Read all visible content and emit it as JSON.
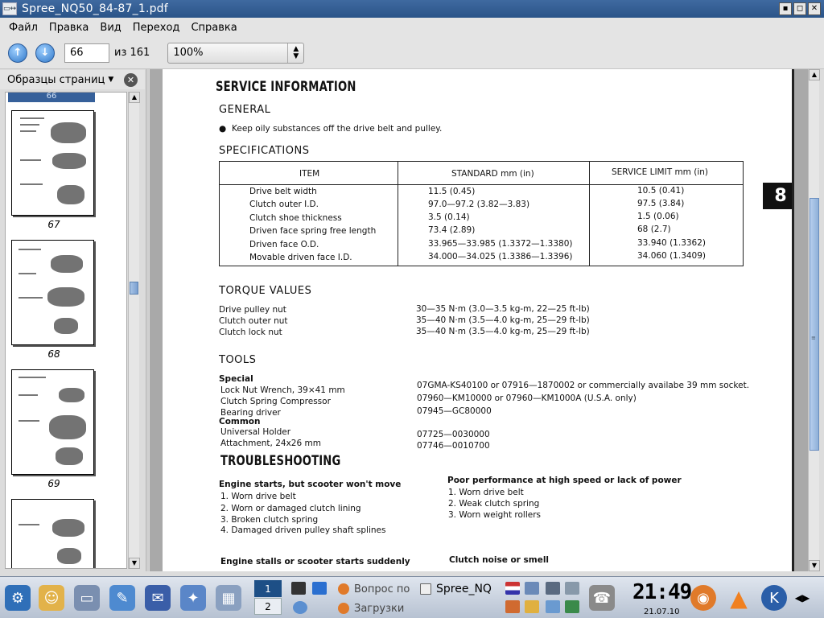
{
  "window": {
    "title": "Spree_NQ50_84-87_1.pdf"
  },
  "menu": [
    "Файл",
    "Правка",
    "Вид",
    "Переход",
    "Справка"
  ],
  "toolbar": {
    "page_value": "66",
    "of_label": "из 161",
    "zoom_value": "100%"
  },
  "sidebar": {
    "title": "Образцы страниц",
    "thumbs": [
      {
        "label": "66"
      },
      {
        "label": "67"
      },
      {
        "label": "68"
      },
      {
        "label": "69"
      }
    ]
  },
  "doc": {
    "service_title": "SERVICE INFORMATION",
    "general_title": "GENERAL",
    "general_bullet": "Keep oily substances off the drive belt and pulley.",
    "spec_title": "SPECIFICATIONS",
    "spec_headers": {
      "item": "ITEM",
      "standard": "STANDARD mm (in)",
      "limit": "SERVICE LIMIT mm (in)"
    },
    "spec_rows": [
      {
        "item": "Drive belt width",
        "std": "11.5 (0.45)",
        "lim": "10.5 (0.41)"
      },
      {
        "item": "Clutch outer I.D.",
        "std": "97.0—97.2 (3.82—3.83)",
        "lim": "97.5 (3.84)"
      },
      {
        "item": "Clutch shoe thickness",
        "std": "3.5 (0.14)",
        "lim": "1.5 (0.06)"
      },
      {
        "item": "Driven face spring free length",
        "std": "73.4 (2.89)",
        "lim": "68 (2.7)"
      },
      {
        "item": "Driven face O.D.",
        "std": "33.965—33.985 (1.3372—1.3380)",
        "lim": "33.940 (1.3362)"
      },
      {
        "item": "Movable driven face I.D.",
        "std": "34.000—34.025 (1.3386—1.3396)",
        "lim": "34.060 (1.3409)"
      }
    ],
    "chapter_badge": "8",
    "torque_title": "TORQUE VALUES",
    "torque_rows": [
      {
        "name": "Drive pulley nut",
        "val": "30—35 N·m (3.0—3.5 kg-m, 22—25 ft-lb)"
      },
      {
        "name": "Clutch outer nut",
        "val": "35—40 N·m (3.5—4.0 kg-m, 25—29 ft-lb)"
      },
      {
        "name": "Clutch lock nut",
        "val": "35—40 N·m (3.5—4.0 kg-m, 25—29 ft-lb)"
      }
    ],
    "tools_title": "TOOLS",
    "tools_special": "Special",
    "tools_common": "Common",
    "tools_rows": [
      {
        "name": "Lock Nut Wrench, 39×41 mm",
        "val": "07GMA-KS40100 or 07916—1870002 or commercially availabe 39 mm socket."
      },
      {
        "name": "Clutch Spring Compressor",
        "val": "07960—KM10000 or 07960—KM1000A (U.S.A. only)"
      },
      {
        "name": "Bearing driver",
        "val": "07945—GC80000"
      },
      {
        "name": "Universal Holder",
        "val": "07725—0030000"
      },
      {
        "name": "Attachment, 24x26 mm",
        "val": "07746—0010700"
      }
    ],
    "trouble_title": "TROUBLESHOOTING",
    "trouble_left_head": "Engine starts, but scooter won't move",
    "trouble_left_items": [
      "1.  Worn drive belt",
      "2.  Worn or damaged clutch lining",
      "3.  Broken clutch spring",
      "4.  Damaged driven pulley shaft splines"
    ],
    "trouble_right_head": "Poor performance at high speed or lack of power",
    "trouble_right_items": [
      "1.  Worn drive belt",
      "2.  Weak clutch spring",
      "3.  Worn weight rollers"
    ],
    "trouble_left_head2": "Engine stalls or scooter starts suddenly",
    "trouble_right_head2": "Clutch noise or smell"
  },
  "taskbar": {
    "pager": [
      "1",
      "2"
    ],
    "tasks": [
      "Вопрос по",
      "Spree_NQ",
      "Загрузки"
    ],
    "clock": "21:49",
    "date": "21.07.10"
  }
}
